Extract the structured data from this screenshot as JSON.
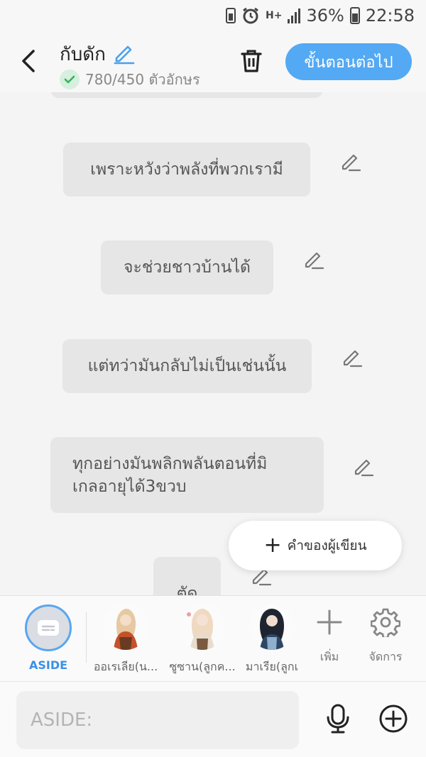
{
  "status_bar": {
    "battery": "36%",
    "time": "22:58",
    "network": "H+"
  },
  "header": {
    "title": "กับดัก",
    "char_count": "780/450 ตัวอักษร",
    "next_label": "ขั้นตอนต่อไป"
  },
  "messages": [
    {
      "text": "เพราะหวังว่าพลังที่พวกเรามี"
    },
    {
      "text": "จะช่วยชาวบ้านได้"
    },
    {
      "text": "แต่ทว่ามันกลับไม่เป็นเช่นนั้น"
    },
    {
      "text": "ทุกอย่างมันพลิกพลันตอนที่มิ\nเกลอายุได้3ขวบ"
    },
    {
      "text": "ตัด"
    }
  ],
  "fab": {
    "label": "คำของผู้เขียน"
  },
  "characters": {
    "aside_label": "ASIDE",
    "items": [
      {
        "name": "ออเรเลีย(น..."
      },
      {
        "name": "ซูซาน(ลูกค..."
      },
      {
        "name": "มาเรีย(ลูกเ"
      }
    ],
    "add_label": "เพิ่ม",
    "manage_label": "จัดการ"
  },
  "input": {
    "placeholder": "ASIDE:"
  },
  "colors": {
    "accent": "#53a9f3",
    "bubble": "#e6e6e6",
    "background": "#f4f4f4"
  }
}
